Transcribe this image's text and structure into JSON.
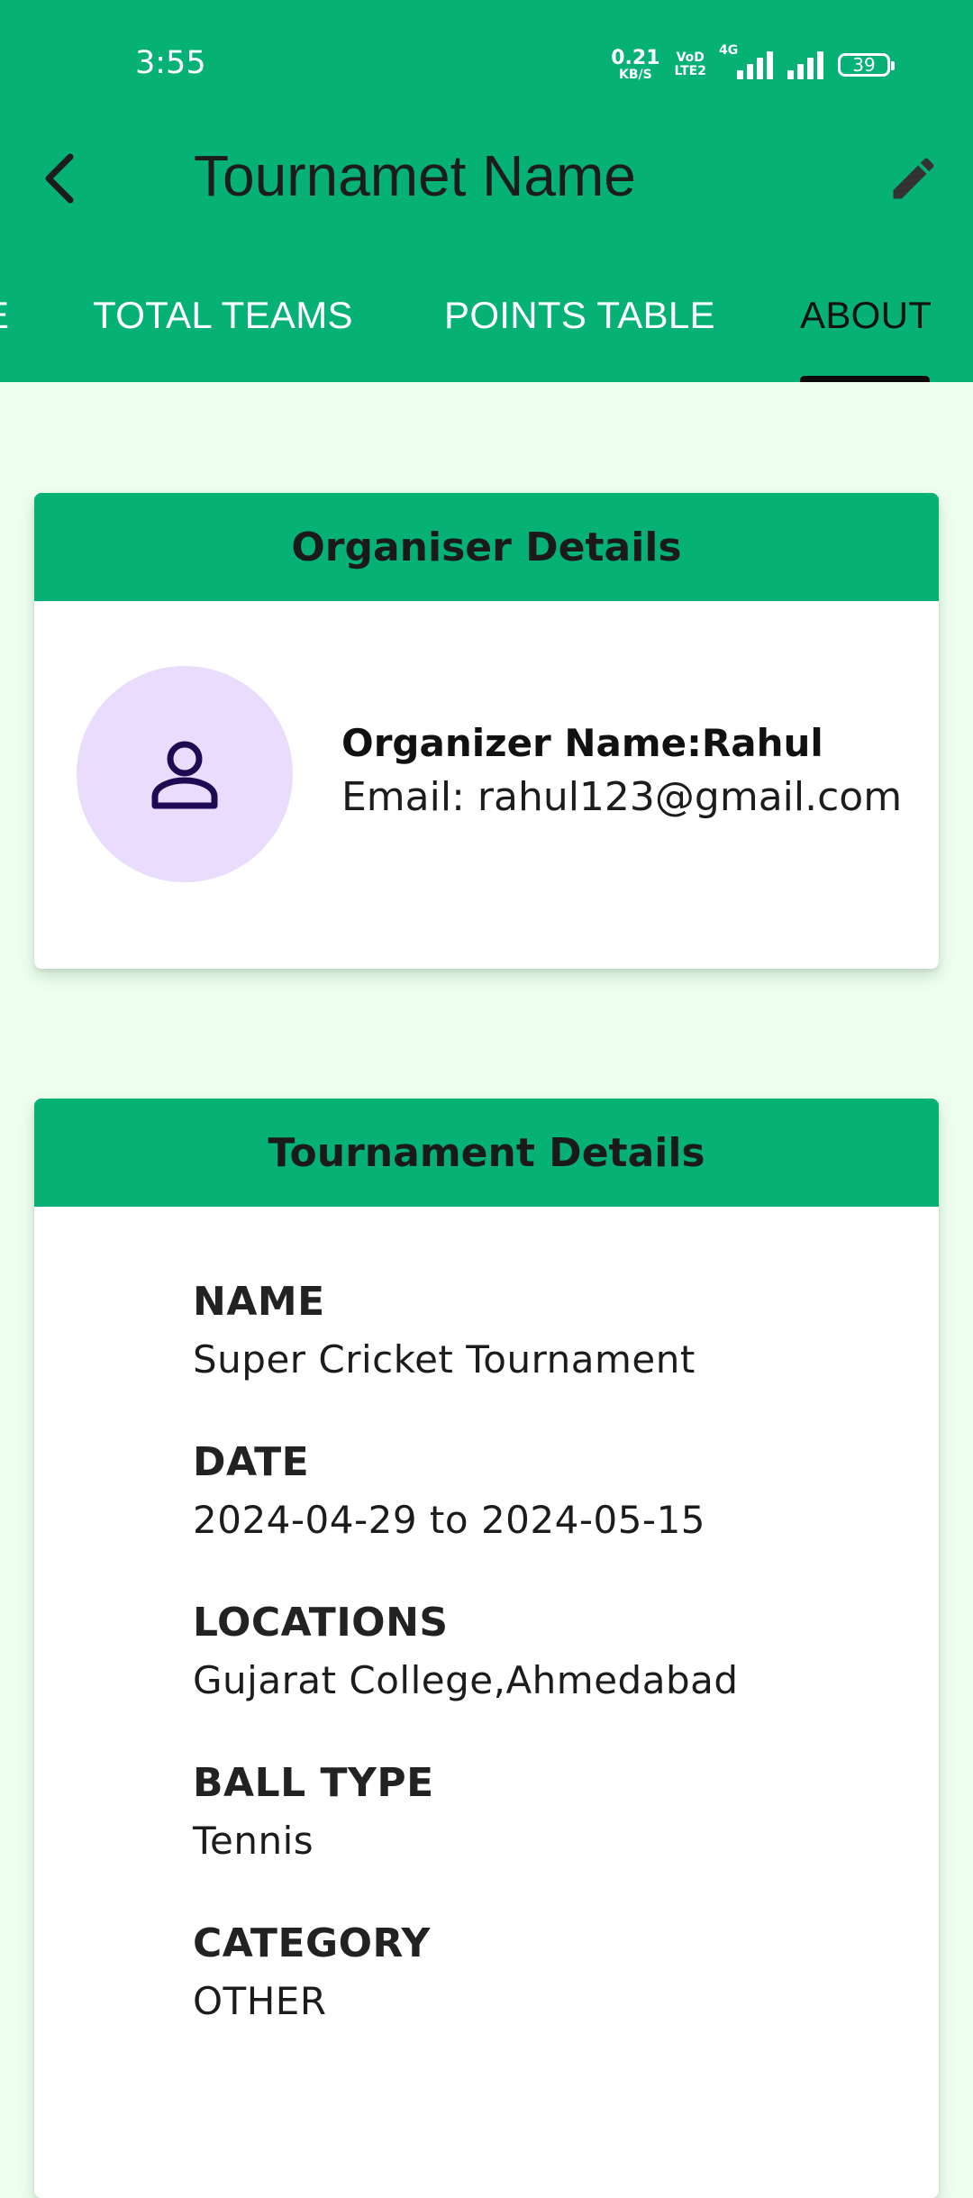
{
  "status_bar": {
    "time": "3:55",
    "net_speed_value": "0.21",
    "net_speed_unit": "KB/S",
    "volte_top": "VoD",
    "volte_bottom": "LTE2",
    "network_type": "4G",
    "battery_level": "39"
  },
  "header": {
    "title": "Tournamet Name",
    "back_icon": "arrow-back-icon",
    "edit_icon": "pencil-icon",
    "background_color": "#05b174"
  },
  "tabs": [
    {
      "label": "E",
      "active": false
    },
    {
      "label": "TOTAL TEAMS",
      "active": false
    },
    {
      "label": "POINTS TABLE",
      "active": false
    },
    {
      "label": "ABOUT",
      "active": true
    }
  ],
  "organiser": {
    "section_title": "Organiser Details",
    "name_label": "Organizer Name:Rahul",
    "email_label": "Email: rahul123@gmail.com",
    "avatar_icon": "person-icon"
  },
  "tournament": {
    "section_title": "Tournament Details",
    "details": [
      {
        "label": "NAME",
        "value": "Super Cricket Tournament"
      },
      {
        "label": "DATE",
        "value": "2024-04-29 to 2024-05-15"
      },
      {
        "label": "LOCATIONS",
        "value": "Gujarat College,Ahmedabad"
      },
      {
        "label": "BALL TYPE",
        "value": "Tennis"
      },
      {
        "label": "CATEGORY",
        "value": "OTHER"
      }
    ]
  },
  "colors": {
    "accent": "#05b174",
    "page_background": "#efffef",
    "avatar_background": "#e9dcfd",
    "avatar_icon": "#1e0a52"
  }
}
